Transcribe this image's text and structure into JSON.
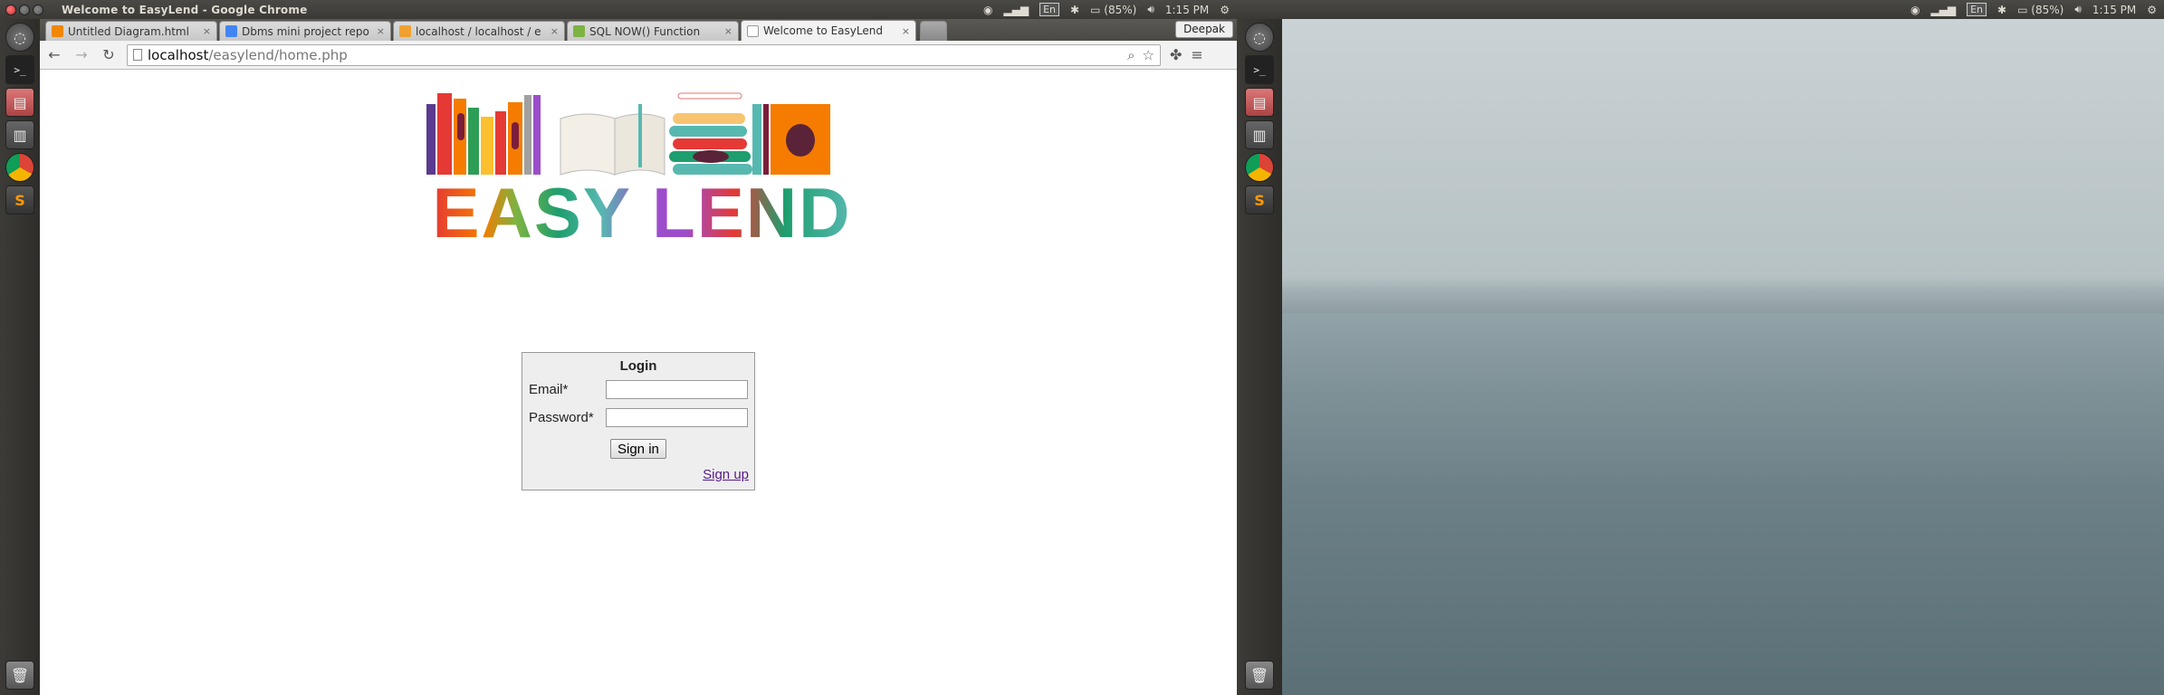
{
  "panel": {
    "window_title": "Welcome to EasyLend - Google Chrome",
    "battery": "(85%)",
    "time": "1:15 PM",
    "keyboard_layout": "En"
  },
  "panel2": {
    "battery": "(85%)",
    "time": "1:15 PM",
    "keyboard_layout": "En"
  },
  "browser": {
    "tabs": [
      {
        "title": "Untitled Diagram.html",
        "favicon_color": "#f08705",
        "active": false
      },
      {
        "title": "Dbms mini project repo",
        "favicon_color": "#4285f4",
        "active": false
      },
      {
        "title": "localhost / localhost / e",
        "favicon_color": "#f0a030",
        "active": false
      },
      {
        "title": "SQL NOW() Function",
        "favicon_color": "#7cb342",
        "active": false
      },
      {
        "title": "Welcome to EasyLend",
        "favicon_color": "#ffffff",
        "active": true
      }
    ],
    "profile_name": "Deepak",
    "url_host": "localhost",
    "url_path": "/easylend/home.php"
  },
  "page": {
    "logo_text": "EASY LEND",
    "login": {
      "heading": "Login",
      "email_label": "Email*",
      "password_label": "Password*",
      "email_value": "",
      "password_value": "",
      "signin_label": "Sign in",
      "signup_label": "Sign up"
    }
  },
  "colors": {
    "logo_letters": [
      "#e53935",
      "#f57c00",
      "#7cb342",
      "#1e9e6e",
      "#57b8b0",
      "#9c4dcc",
      "#ffffff",
      "#9c4dcc",
      "#e53935",
      "#1e9e6e",
      "#57b8b0"
    ]
  },
  "icons": {
    "launcher_left": [
      "dash-icon",
      "terminal-icon",
      "files-icon",
      "drive-icon",
      "chrome-icon",
      "sublime-icon",
      "trash-icon"
    ],
    "launcher_right": [
      "dash-icon",
      "terminal-icon",
      "files-icon",
      "drive-icon",
      "chrome-icon",
      "sublime-icon",
      "trash-icon"
    ]
  }
}
